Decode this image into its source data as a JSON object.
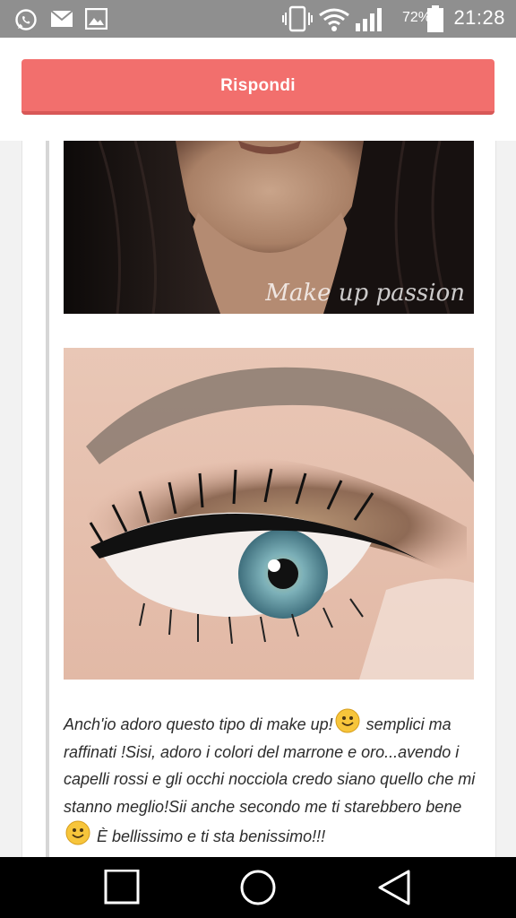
{
  "status_bar": {
    "battery_percent": "72%",
    "time": "21:28",
    "icons": [
      "whatsapp-icon",
      "email-icon",
      "gallery-icon",
      "vibrate-icon",
      "wifi-icon",
      "signal-icon",
      "battery-icon"
    ]
  },
  "reply": {
    "label": "Rispondi"
  },
  "post": {
    "watermark": "Make up passion",
    "text_part1": "Anch'io adoro questo tipo di make up!",
    "text_part2": " semplici ma raffinati !Sisi, adoro i colori del marrone e oro...avendo i capelli rossi e gli occhi nocciola credo siano quello che mi stanno meglio!Sii anche secondo me ti starebbero bene",
    "text_part3": " È bellissimo e ti sta benissimo!!!"
  },
  "nav_bar": {
    "buttons": [
      "recents-button",
      "home-button",
      "back-button"
    ]
  },
  "colors": {
    "accent": "#f26f6d",
    "status_bar": "#8f8f8f",
    "nav_bar": "#000000"
  }
}
